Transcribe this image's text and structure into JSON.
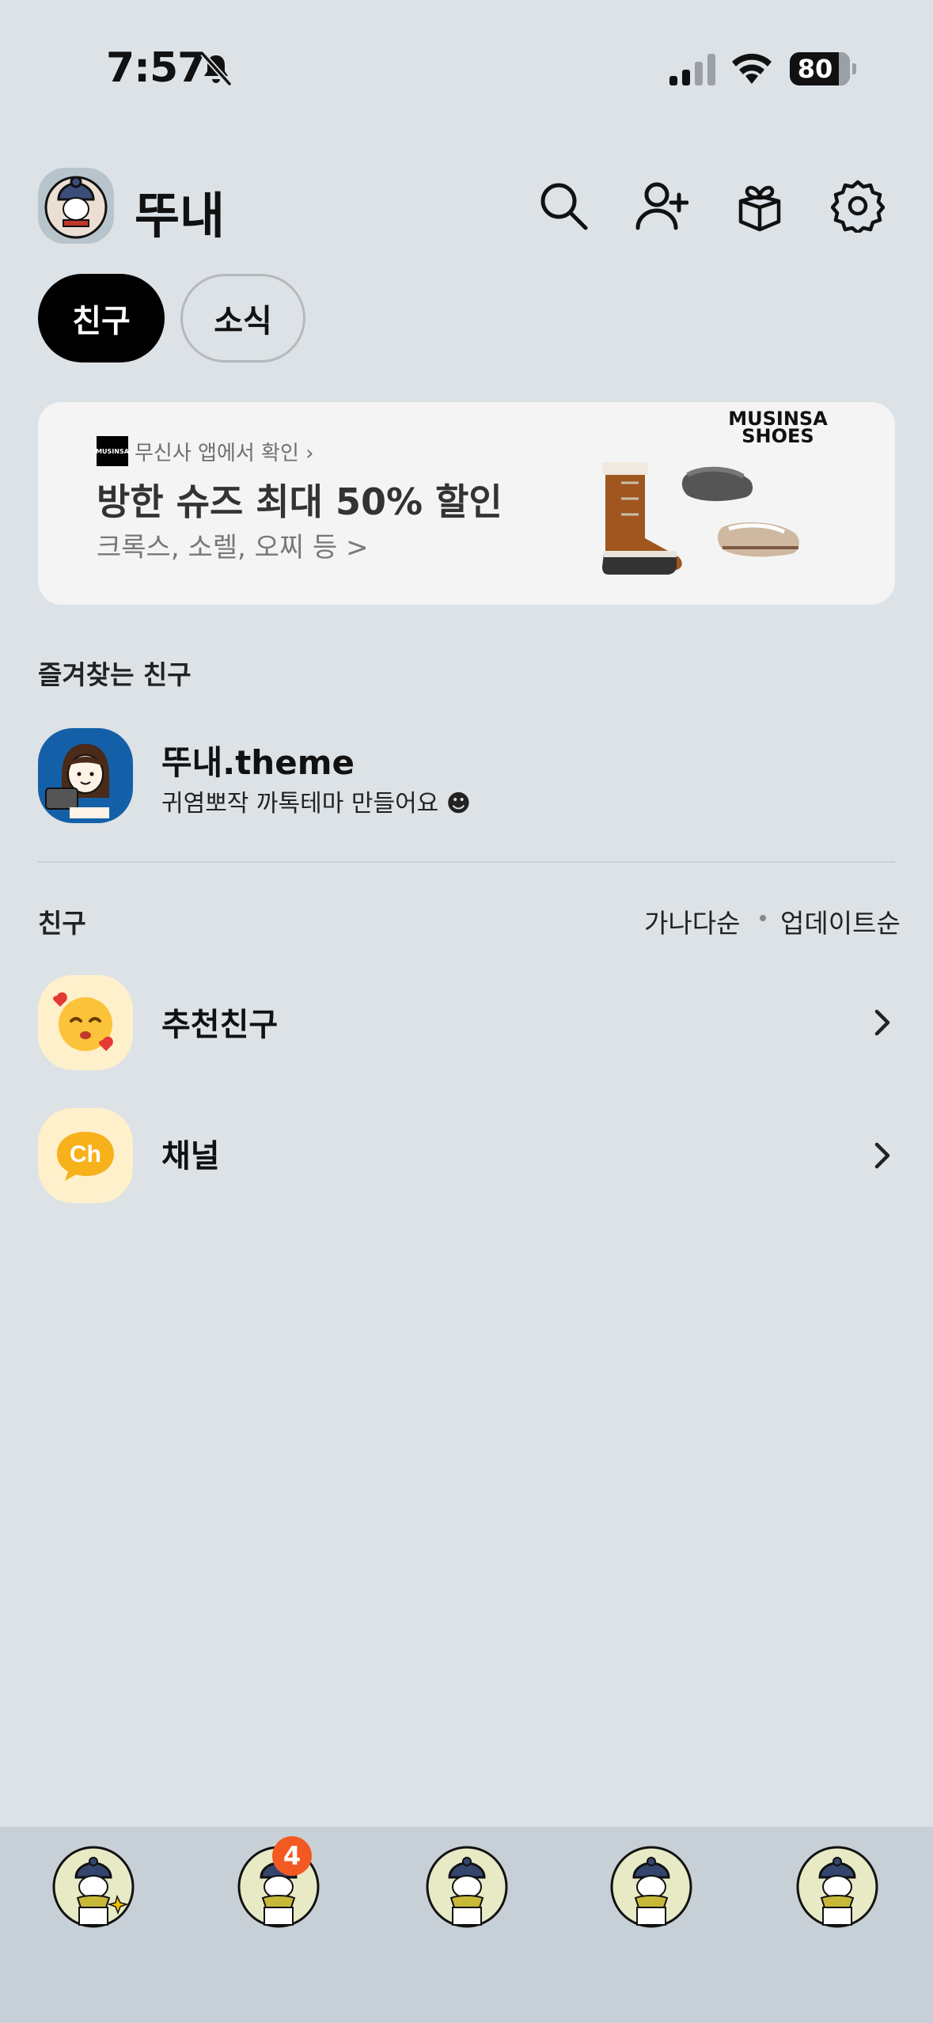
{
  "status_bar": {
    "time": "7:57",
    "battery": "80",
    "icons": [
      "bell-muted-icon",
      "signal-icon",
      "wifi-icon",
      "battery-icon"
    ]
  },
  "header": {
    "profile_name": "뚜내",
    "icons": [
      "search-icon",
      "add-friend-icon",
      "gift-icon",
      "settings-icon"
    ]
  },
  "tabs": [
    {
      "label": "친구",
      "selected": true
    },
    {
      "label": "소식",
      "selected": false
    }
  ],
  "ad": {
    "logo_text": "MUSINSA",
    "source": "무신사 앱에서 확인 ›",
    "title": "방한 슈즈 최대 50% 할인",
    "subtitle": "크록스, 소렐, 오찌 등 >",
    "brand_line1": "MUSINSA",
    "brand_line2": "SHOES"
  },
  "favorites": {
    "label": "즐겨찾는 친구",
    "items": [
      {
        "name": "뚜내.theme",
        "status": "귀염뽀작 까톡테마 만들어요 ☻"
      }
    ]
  },
  "friends": {
    "label": "친구",
    "sort_options": [
      "가나다순",
      "업데이트순"
    ],
    "rows": [
      {
        "label": "추천친구",
        "icon": "recommend-emoji-icon"
      },
      {
        "label": "채널",
        "icon": "channel-ch-icon",
        "icon_text": "Ch"
      }
    ]
  },
  "bottom_nav": {
    "items": [
      "friends-tab",
      "chats-tab",
      "openchat-tab",
      "shopping-tab",
      "more-tab"
    ],
    "badge": "4"
  },
  "colors": {
    "background": "#dde2e6",
    "nav_background": "#c7d0d6",
    "badge": "#f25a22",
    "tab_active": "#000000"
  }
}
